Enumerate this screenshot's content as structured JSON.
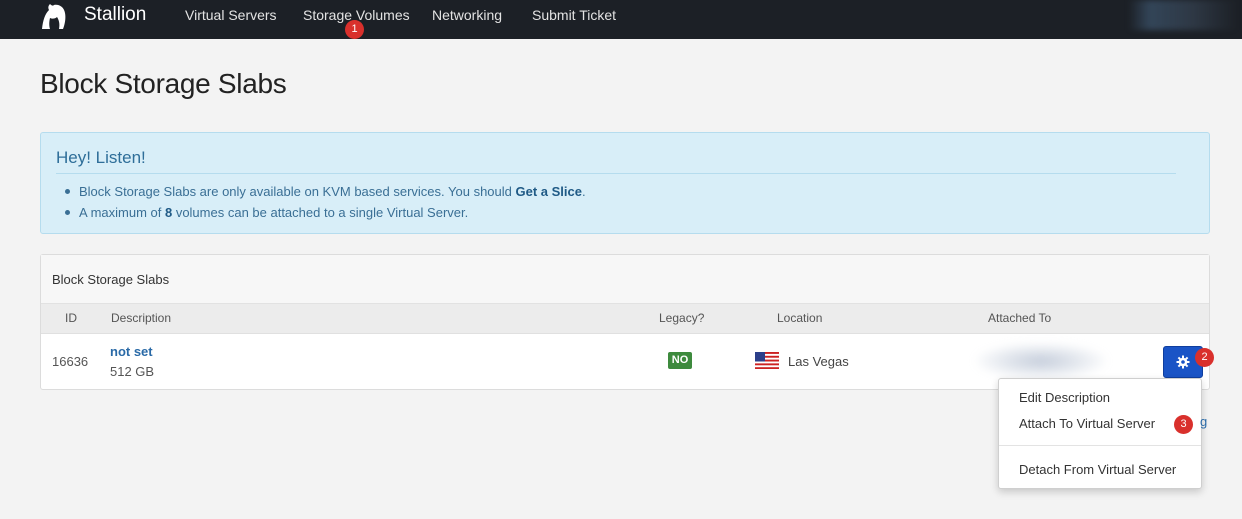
{
  "nav": {
    "brand": "Stallion",
    "items": [
      "Virtual Servers",
      "Storage Volumes",
      "Networking",
      "Submit Ticket"
    ]
  },
  "annotations": [
    "1",
    "2",
    "3"
  ],
  "page": {
    "title": "Block Storage Slabs"
  },
  "alert": {
    "title": "Hey! Listen!",
    "line1_text": "Block Storage Slabs are only available on KVM based services. You should ",
    "line1_link": "Get a Slice",
    "line1_end": ".",
    "line2_pre": "A maximum of ",
    "line2_count": "8",
    "line2_post": " volumes can be attached to a single Virtual Server."
  },
  "panel": {
    "title": "Block Storage Slabs",
    "columns": [
      "ID",
      "Description",
      "Legacy?",
      "Location",
      "Attached To"
    ],
    "rows": [
      {
        "id": "16636",
        "description": "not set",
        "size": "512 GB",
        "legacy": "NO",
        "location": "Las Vegas",
        "flag_icon": "us-flag-icon"
      }
    ]
  },
  "dropdown": {
    "items": [
      "Edit Description",
      "Attach To Virtual Server",
      "Detach From Virtual Server"
    ]
  },
  "peek_text": "g",
  "colors": {
    "navbar": "#1c2026",
    "alert_bg": "#d8eef8",
    "primary_button": "#1a54c6",
    "legacy_badge": "#3d8a3d",
    "annotation_badge": "#d9302c"
  }
}
